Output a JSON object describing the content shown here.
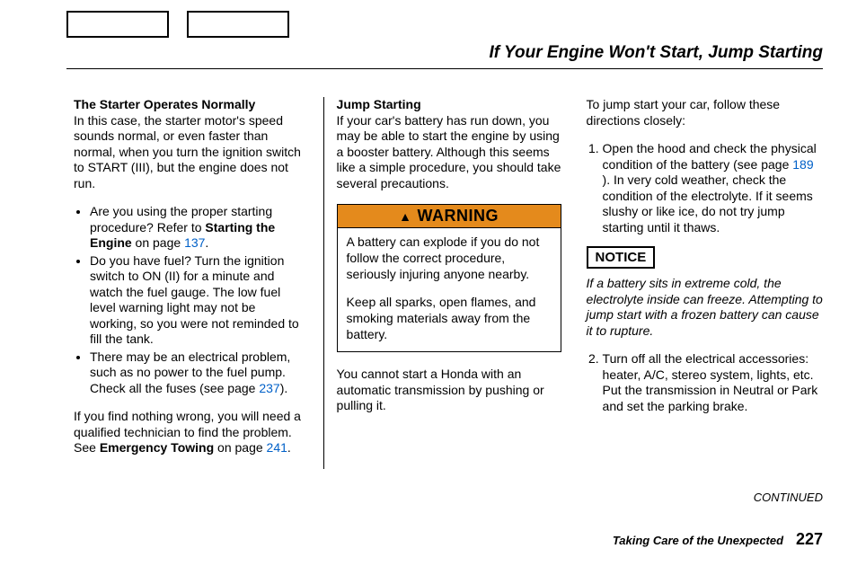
{
  "title": "If Your Engine Won't Start, Jump Starting",
  "col1": {
    "heading": "The Starter Operates Normally",
    "intro": "In this case, the starter motor's speed sounds normal, or even faster than normal, when you turn the ignition switch to START (III), but the engine does not run.",
    "b1a": "Are you using the proper starting procedure? Refer to ",
    "b1b": "Starting the Engine",
    "b1c": " on page ",
    "b1d": "137",
    "b1e": ".",
    "b2": "Do you have fuel? Turn the ignition switch to ON (II) for a minute and watch the fuel gauge. The low fuel level warning light may not be working, so you were not reminded to fill the tank.",
    "b3a": "There may be an electrical problem, such as no power to the fuel pump. Check all the fuses (see page ",
    "b3b": "237",
    "b3c": ").",
    "out1": "If you find nothing wrong, you will need a qualified technician to find the problem. See ",
    "out2": "Emergency Towing",
    "out3": " on page ",
    "out4": "241",
    "out5": "."
  },
  "col2": {
    "heading": "Jump Starting",
    "intro": "If your car's battery has run down, you may be able to start the engine by using a booster battery. Although this seems like a simple procedure, you should take several precautions.",
    "warnLabel": "WARNING",
    "warn1": "A battery can explode if you do not follow the correct procedure, seriously injuring anyone nearby.",
    "warn2": "Keep all sparks, open flames, and smoking materials away from the battery.",
    "after": "You cannot start a Honda with an automatic transmission by pushing or pulling it."
  },
  "col3": {
    "intro": "To jump start your car, follow these directions closely:",
    "s1a": "Open the hood and check the physical condition of the battery (see page ",
    "s1b": "189",
    "s1c": " ). In very cold weather, check the condition of the electrolyte. If it seems slushy or like ice, do not try jump starting until it thaws.",
    "noticeLabel": "NOTICE",
    "notice": "If a battery sits in extreme cold, the electrolyte inside can freeze. Attempting to jump start with a frozen battery can cause it to rupture.",
    "s2a": "Turn off all the electrical accessories: heater, A/C, stereo system, lights, etc.",
    "s2b": "Put the transmission in Neutral or Park and set the parking brake."
  },
  "continued": "CONTINUED",
  "footerLabel": "Taking Care of the Unexpected",
  "pageNumber": "227"
}
